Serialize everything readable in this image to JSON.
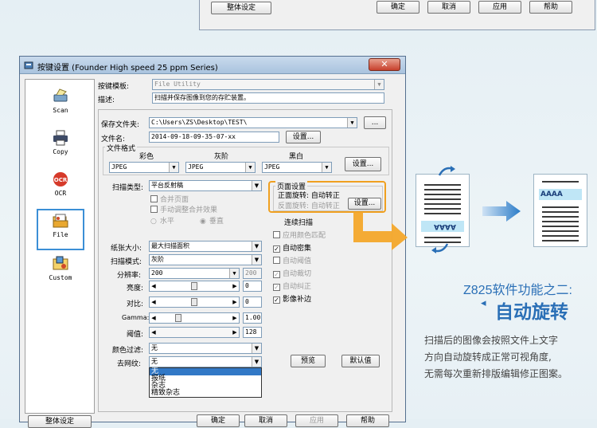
{
  "top_dialog": {
    "overall_settings": "整体设定",
    "ok": "确定",
    "cancel": "取消",
    "apply": "应用",
    "help": "帮助"
  },
  "dialog": {
    "title": "按键设置 (Founder High speed 25 ppm Series)",
    "close_symbol": "✕",
    "sidebar": [
      {
        "label": "Scan",
        "icon": "scanner-icon"
      },
      {
        "label": "Copy",
        "icon": "printer-icon"
      },
      {
        "label": "OCR",
        "icon": "ocr-icon"
      },
      {
        "label": "File",
        "icon": "file-icon",
        "selected": true
      },
      {
        "label": "Custom",
        "icon": "custom-icon"
      }
    ],
    "template_label": "按键模板:",
    "template_value": "File Utility",
    "desc_label": "描述:",
    "desc_value": "扫描并保存图像到您的存贮装置。",
    "save_folder_label": "保存文件夹:",
    "save_folder_value": "C:\\Users\\ZS\\Desktop\\TEST\\",
    "browse": "...",
    "filename_label": "文件名:",
    "filename_value": "2014-09-18-09-35-07-xx",
    "settings_btn": "设置...",
    "file_format_title": "文件格式",
    "color_label": "彩色",
    "gray_label": "灰阶",
    "bw_label": "黑白",
    "color_format": "JPEG",
    "gray_format": "JPEG",
    "bw_format": "JPEG",
    "scan_type_label": "扫描类型:",
    "scan_type_value": "平台反射稿",
    "merge_pages": "合并页面",
    "manual_merge": "手动调整合并效果",
    "horizontal": "水平",
    "vertical": "垂直",
    "page_settings_title": "页面设置",
    "front_rotate": "正面旋转: 自动转正",
    "back_rotate": "反面旋转: 自动转正",
    "page_settings_btn": "设置...",
    "continuous_scan": "连续扫描",
    "apply_color_match": "应用颜色匹配",
    "auto_density": "自动密集",
    "auto_threshold": "自动阈值",
    "auto_crop": "自动裁切",
    "auto_deskew": "自动纠正",
    "image_fill": "影像补边",
    "paper_size_label": "纸张大小:",
    "paper_size_value": "最大扫描面积",
    "scan_mode_label": "扫描模式:",
    "scan_mode_value": "灰阶",
    "resolution_label": "分辨率:",
    "resolution_value": "200",
    "resolution_side": "200",
    "brightness_label": "亮度:",
    "brightness_value": "0",
    "contrast_label": "对比:",
    "contrast_value": "0",
    "gamma_label": "Gamma:",
    "gamma_value": "1.00",
    "threshold_label": "阈值:",
    "threshold_value": "128",
    "color_filter_label": "颜色过滤:",
    "color_filter_value": "无",
    "descreen_label": "去网纹:",
    "descreen_value": "无",
    "descreen_options": [
      "无",
      "报纸",
      "杂志",
      "精致杂志"
    ],
    "preview": "预览",
    "default": "默认值",
    "bottom_overall": "整体设定",
    "bottom_ok": "确定",
    "bottom_cancel": "取消",
    "bottom_apply": "应用",
    "bottom_help": "帮助"
  },
  "infographic": {
    "doc_text_before": "AAAA",
    "doc_text_after": "AAAA",
    "feature_title": "Z825软件功能之二:",
    "feature_bullet": "◂",
    "feature_name": "自动旋转",
    "desc_line1": "扫描后的图像会按照文件上文字",
    "desc_line2": "方向自动旋转成正常可视角度,",
    "desc_line3": "无需每次重新排版编辑修正图案。",
    "accent_color": "#2a6fb6",
    "highlight_color": "#f0a020"
  }
}
